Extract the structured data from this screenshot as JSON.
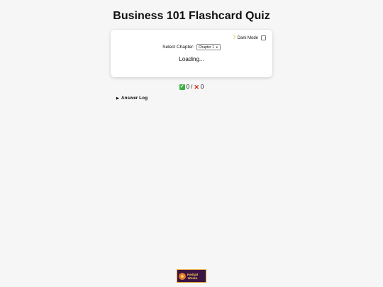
{
  "page": {
    "title": "Business 101 Flashcard Quiz"
  },
  "card": {
    "dark_mode_label": "Dark Mode",
    "dark_mode_checked": false,
    "chapter_label": "Select Chapter:",
    "chapter_selected": "Chapter 1",
    "loading_text": "Loading..."
  },
  "score": {
    "correct": "0",
    "separator": "/",
    "wrong": "0"
  },
  "answer_log": {
    "label": "Answer Log"
  },
  "logo": {
    "line1": "Redtail",
    "line2": "Works"
  },
  "icons": {
    "moon": "moon-icon",
    "check": "check-icon",
    "cross": "cross-icon",
    "expand": "triangle-right-icon"
  },
  "colors": {
    "background": "#f6f6f6",
    "card": "#ffffff",
    "check_green": "#3cb043",
    "cross_red": "#d9261c",
    "logo_bg": "#3a1442",
    "logo_accent": "#f4c860"
  }
}
